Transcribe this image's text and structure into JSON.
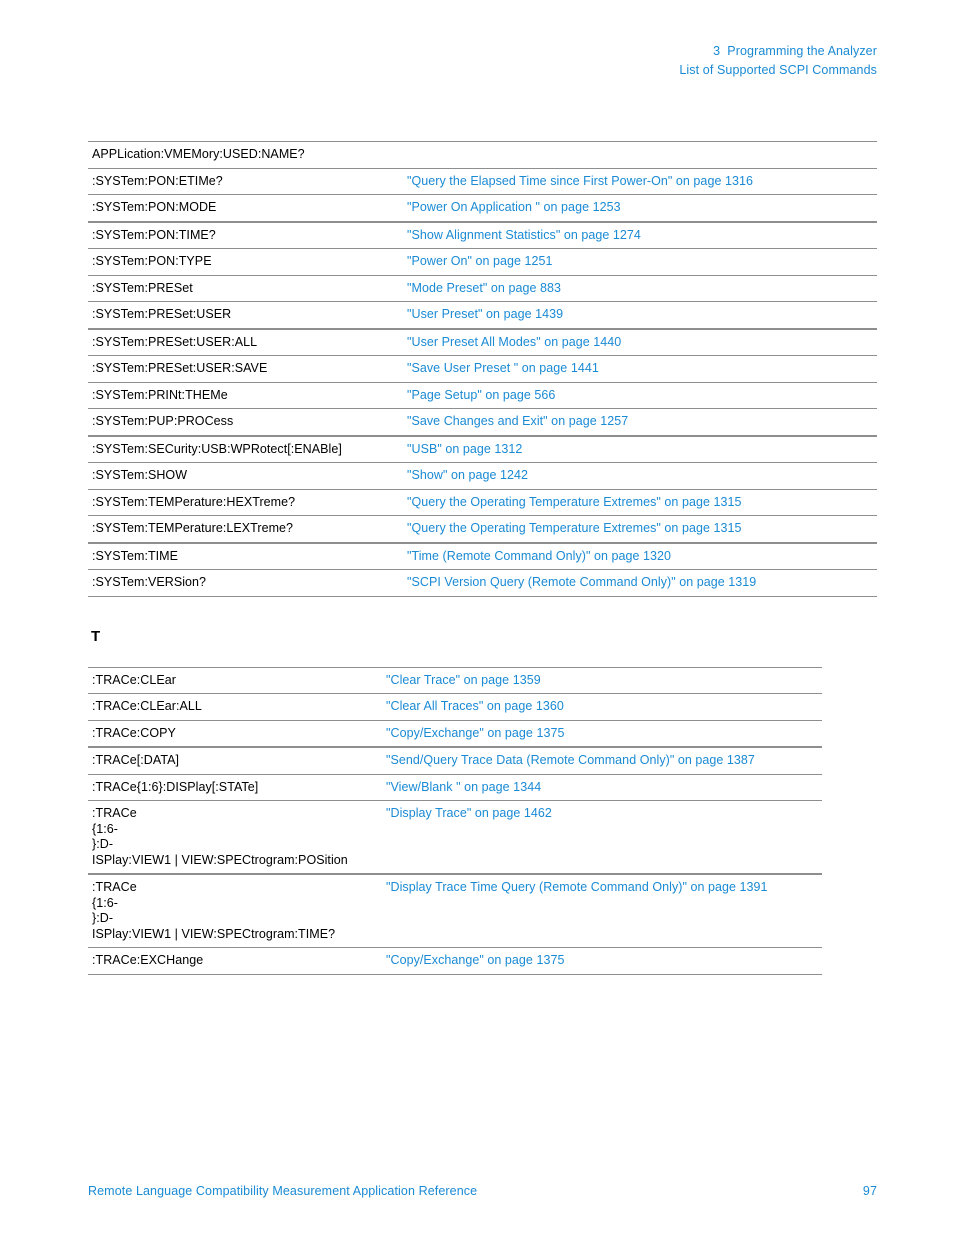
{
  "header": {
    "chapter_line": "3  Programming the Analyzer",
    "section_line": "List of Supported SCPI Commands"
  },
  "section_letter": "T",
  "tables": [
    {
      "name": "system-commands-table",
      "rows": [
        {
          "command": "APPLication:VMEMory:USED:NAME?",
          "link": "",
          "thick": false
        },
        {
          "command": ":SYSTem:PON:ETIMe?",
          "link": "\"Query the Elapsed Time since First Power-On\" on page 1316",
          "thick": false
        },
        {
          "command": ":SYSTem:PON:MODE",
          "link": "\"Power On Application \" on page 1253",
          "thick": false
        },
        {
          "command": ":SYSTem:PON:TIME?",
          "link": "\"Show Alignment Statistics\" on page 1274",
          "thick": true
        },
        {
          "command": ":SYSTem:PON:TYPE",
          "link": "\"Power On\" on page 1251",
          "thick": false
        },
        {
          "command": ":SYSTem:PRESet",
          "link": "\"Mode Preset\" on page 883",
          "thick": false
        },
        {
          "command": ":SYSTem:PRESet:USER",
          "link": "\"User Preset\" on page 1439",
          "thick": false
        },
        {
          "command": ":SYSTem:PRESet:USER:ALL",
          "link": "\"User Preset All Modes\" on page 1440",
          "thick": true
        },
        {
          "command": ":SYSTem:PRESet:USER:SAVE",
          "link": "\"Save User Preset \" on page 1441",
          "thick": false
        },
        {
          "command": ":SYSTem:PRINt:THEMe",
          "link": "\"Page Setup\" on page 566",
          "thick": false
        },
        {
          "command": ":SYSTem:PUP:PROCess",
          "link": "\"Save Changes and Exit\" on page 1257",
          "thick": false
        },
        {
          "command": ":SYSTem:SECurity:USB:WPRotect[:ENABle]",
          "link": "\"USB\" on page 1312",
          "thick": true
        },
        {
          "command": ":SYSTem:SHOW",
          "link": "\"Show\" on page 1242",
          "thick": false
        },
        {
          "command": ":SYSTem:TEMPerature:HEXTreme?",
          "link": "\"Query the Operating Temperature Extremes\" on page 1315",
          "thick": false
        },
        {
          "command": ":SYSTem:TEMPerature:LEXTreme?",
          "link": "\"Query the Operating Temperature Extremes\" on page 1315",
          "thick": false
        },
        {
          "command": ":SYSTem:TIME",
          "link": "\"Time (Remote Command Only)\" on page 1320",
          "thick": true
        },
        {
          "command": ":SYSTem:VERSion?",
          "link": "\"SCPI Version Query (Remote Command Only)\" on page 1319",
          "thick": false
        }
      ]
    },
    {
      "name": "trace-commands-table",
      "rows": [
        {
          "command": ":TRACe:CLEar",
          "link": "\"Clear Trace\" on page 1359",
          "thick": false
        },
        {
          "command": ":TRACe:CLEar:ALL",
          "link": "\"Clear All Traces\" on page 1360",
          "thick": false
        },
        {
          "command": ":TRACe:COPY",
          "link": "\"Copy/Exchange\" on page 1375",
          "thick": false
        },
        {
          "command": ":TRACe[:DATA]",
          "link": "\"Send/Query Trace Data (Remote Command Only)\" on page 1387",
          "thick": true
        },
        {
          "command": ":TRACe{1:6}:DISPlay[:STATe]",
          "link": "\"View/Blank \" on page 1344",
          "thick": false
        },
        {
          "command": ":TRACe\n{1:6-\n}:D-\nISPlay:VIEW1 | VIEW:SPECtrogram:POSition",
          "link": "\"Display Trace\" on page 1462",
          "thick": false
        },
        {
          "command": ":TRACe\n{1:6-\n}:D-\nISPlay:VIEW1 | VIEW:SPECtrogram:TIME?",
          "link": "\"Display Trace Time Query (Remote Command Only)\" on page 1391",
          "thick": true
        },
        {
          "command": ":TRACe:EXCHange",
          "link": "\"Copy/Exchange\" on page 1375",
          "thick": false
        }
      ]
    }
  ],
  "footer": {
    "title": "Remote Language Compatibility Measurement Application Reference",
    "page_number": "97"
  },
  "colors": {
    "link_blue": "#1a8ad4",
    "rule_gray": "#8e8e8e",
    "text_black": "#000000"
  }
}
